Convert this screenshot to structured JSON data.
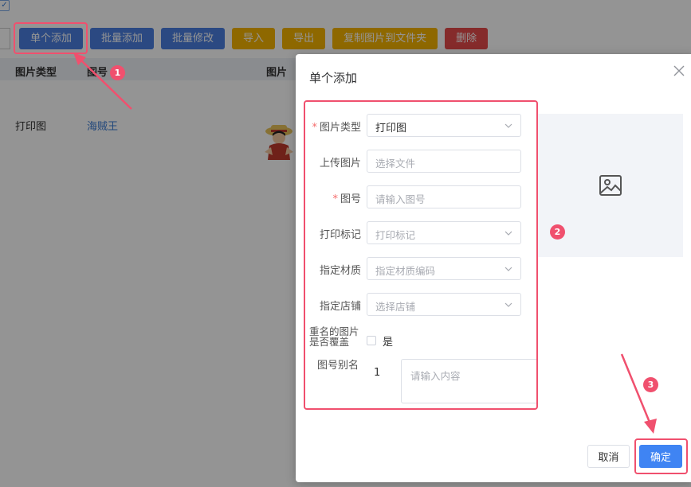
{
  "toolbar": {
    "buttons": [
      {
        "label": "单个添加",
        "color": "#4a7fe0"
      },
      {
        "label": "批量添加",
        "color": "#4a7fe0"
      },
      {
        "label": "批量修改",
        "color": "#4a7fe0"
      },
      {
        "label": "导入",
        "color": "#f5b400"
      },
      {
        "label": "导出",
        "color": "#f5b400"
      },
      {
        "label": "复制图片到文件夹",
        "color": "#f5b400"
      },
      {
        "label": "删除",
        "color": "#e54b4b"
      }
    ]
  },
  "table": {
    "headers": [
      "图片类型",
      "图号",
      "图片"
    ],
    "row": {
      "type": "打印图",
      "number": "海贼王"
    }
  },
  "dialog": {
    "title": "单个添加",
    "fields": {
      "image_type": {
        "label": "图片类型",
        "required": true,
        "value": "打印图"
      },
      "upload": {
        "label": "上传图片",
        "placeholder": "选择文件"
      },
      "number": {
        "label": "图号",
        "required": true,
        "placeholder": "请输入图号"
      },
      "print_mark": {
        "label": "打印标记",
        "placeholder": "打印标记"
      },
      "material": {
        "label": "指定材质",
        "placeholder": "指定材质编码"
      },
      "shop": {
        "label": "指定店铺",
        "placeholder": "选择店铺"
      }
    },
    "overwrite": {
      "label_line1": "重名的图片",
      "label_line2": "是否覆盖",
      "option": "是"
    },
    "alias": {
      "label": "图号别名",
      "index": "1",
      "placeholder": "请输入内容"
    },
    "cancel_label": "取消",
    "confirm_label": "确定"
  },
  "annotations": {
    "badges": [
      "1",
      "2",
      "3"
    ],
    "color": "#f0506e"
  }
}
